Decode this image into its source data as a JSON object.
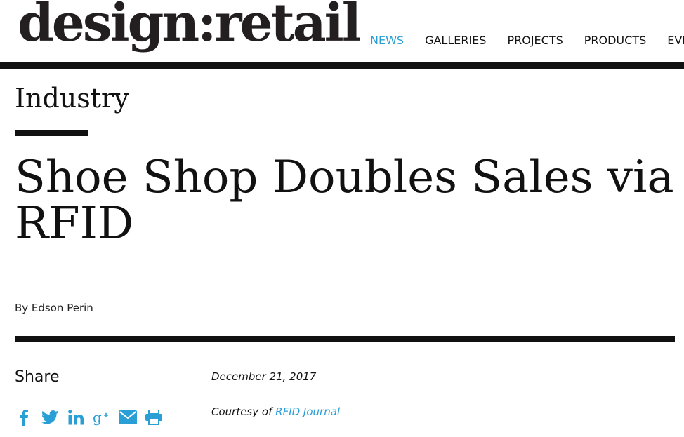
{
  "header": {
    "logo_text": "design:retail",
    "nav": [
      {
        "label": "NEWS",
        "active": true
      },
      {
        "label": "GALLERIES",
        "active": false
      },
      {
        "label": "PROJECTS",
        "active": false
      },
      {
        "label": "PRODUCTS",
        "active": false
      },
      {
        "label": "EVENTS",
        "active": false
      }
    ]
  },
  "article": {
    "category": "Industry",
    "title": "Shoe Shop Doubles Sales via RFID",
    "byline": "By Edson Perin",
    "date": "December 21, 2017",
    "courtesy_prefix": "Courtesy of",
    "courtesy_link": "RFID Journal"
  },
  "share": {
    "label": "Share",
    "icons": [
      "facebook-icon",
      "twitter-icon",
      "linkedin-icon",
      "google-plus-icon",
      "email-icon",
      "print-icon"
    ]
  },
  "colors": {
    "accent": "#2a9fd6",
    "text": "#111111",
    "rule": "#111111"
  }
}
